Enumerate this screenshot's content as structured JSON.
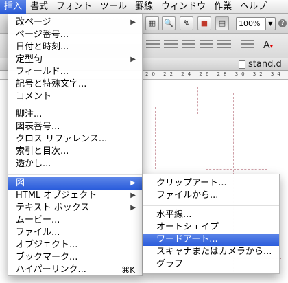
{
  "menubar": {
    "items": [
      "挿入",
      "書式",
      "フォント",
      "ツール",
      "罫線",
      "ウィンドウ",
      "作業",
      "ヘルプ"
    ]
  },
  "toolbar": {
    "zoom": "100%",
    "help_icon": "?"
  },
  "document": {
    "title": "stand.d"
  },
  "ruler": {
    "marks": "20 22 24 26 28 30 32 34 36"
  },
  "insert_menu": {
    "items": [
      {
        "label": "改ページ",
        "has_submenu": true
      },
      {
        "label": "ページ番号..."
      },
      {
        "label": "日付と時刻..."
      },
      {
        "label": "定型句",
        "has_submenu": true
      },
      {
        "label": "フィールド..."
      },
      {
        "label": "記号と特殊文字..."
      },
      {
        "label": "コメント"
      },
      {
        "label": "脚注..."
      },
      {
        "label": "図表番号..."
      },
      {
        "label": "クロス リファレンス..."
      },
      {
        "label": "索引と目次..."
      },
      {
        "label": "透かし..."
      },
      {
        "label": "図",
        "has_submenu": true,
        "highlighted": true
      },
      {
        "label": "HTML オブジェクト",
        "has_submenu": true
      },
      {
        "label": "テキスト ボックス",
        "has_submenu": true
      },
      {
        "label": "ムービー..."
      },
      {
        "label": "ファイル..."
      },
      {
        "label": "オブジェクト..."
      },
      {
        "label": "ブックマーク..."
      },
      {
        "label": "ハイパーリンク...",
        "shortcut": "⌘K"
      }
    ]
  },
  "picture_submenu": {
    "items": [
      {
        "label": "クリップアート..."
      },
      {
        "label": "ファイルから..."
      },
      {
        "label": "水平線..."
      },
      {
        "label": "オートシェイプ"
      },
      {
        "label": "ワードアート...",
        "highlighted": true
      },
      {
        "label": "スキャナまたはカメラから..."
      },
      {
        "label": "グラフ"
      }
    ]
  },
  "colors": {
    "highlight": "#2a5cdb",
    "menu_bg": "#ffffff"
  }
}
